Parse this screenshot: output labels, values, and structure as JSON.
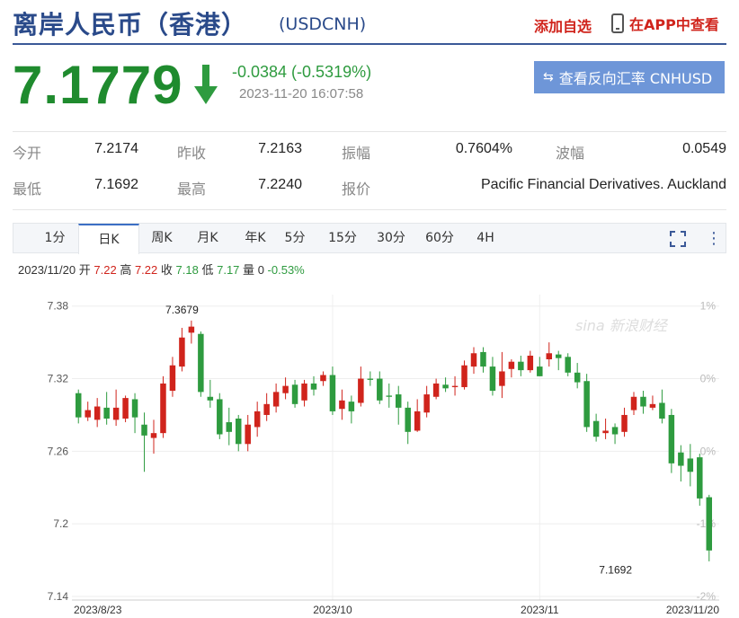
{
  "header": {
    "title": "离岸人民币（香港）",
    "symbol": "(USDCNH)",
    "add_favorite": "添加自选",
    "app_link": "在APP中查看"
  },
  "quote": {
    "price": "7.1779",
    "change": "-0.0384 (-0.5319%)",
    "timestamp": "2023-11-20 16:07:58",
    "reverse_button": "查看反向汇率 CNHUSD",
    "direction": "down",
    "down_color": "#2e9b3f",
    "up_color": "#d0241c"
  },
  "stats": {
    "row1": [
      {
        "label": "今开",
        "value": "7.2174"
      },
      {
        "label": "昨收",
        "value": "7.2163"
      },
      {
        "label": "振幅",
        "value": "0.7604%"
      },
      {
        "label": "波幅",
        "value": "0.0549"
      }
    ],
    "row2": [
      {
        "label": "最低",
        "value": "7.1692"
      },
      {
        "label": "最高",
        "value": "7.2240"
      },
      {
        "label": "报价",
        "value": "Pacific Financial Derivatives. Auckland"
      }
    ]
  },
  "tabs": {
    "items": [
      "1分",
      "日K",
      "周K",
      "月K",
      "年K",
      "5分",
      "15分",
      "30分",
      "60分",
      "4H"
    ],
    "active": "日K"
  },
  "ohlc": {
    "date": "2023/11/20",
    "open_label": "开",
    "open": "7.22",
    "high_label": "高",
    "high": "7.22",
    "close_label": "收",
    "close": "7.18",
    "low_label": "低",
    "low": "7.17",
    "vol_label": "量",
    "vol": "0",
    "pct": "-0.53%"
  },
  "chart_data": {
    "type": "candlestick",
    "watermark": "sina 新浪财经",
    "y_ticks": [
      "7.38",
      "7.32",
      "7.26",
      "7.2",
      "7.14"
    ],
    "y_ticks_values": [
      7.38,
      7.32,
      7.26,
      7.2,
      7.14
    ],
    "pct_ticks": [
      "1%",
      "0%",
      "0%",
      "-1%",
      "-2%"
    ],
    "x_ticks": [
      "2023/8/23",
      "2023/10",
      "2023/11",
      "2023/11/20"
    ],
    "x_ticks_index": [
      0,
      27,
      49,
      58
    ],
    "ylim": [
      7.14,
      7.385
    ],
    "annotations": [
      {
        "label": "7.3679",
        "index": 11,
        "value": 7.3679
      },
      {
        "label": "7.1692",
        "index": 59,
        "value": 7.1692
      }
    ],
    "candles": [
      [
        7.308,
        7.288,
        7.311,
        7.283
      ],
      [
        7.288,
        7.294,
        7.301,
        7.285
      ],
      [
        7.286,
        7.297,
        7.304,
        7.28
      ],
      [
        7.296,
        7.287,
        7.309,
        7.282
      ],
      [
        7.286,
        7.296,
        7.311,
        7.281
      ],
      [
        7.287,
        7.304,
        7.306,
        7.284
      ],
      [
        7.303,
        7.288,
        7.308,
        7.275
      ],
      [
        7.282,
        7.273,
        7.292,
        7.243
      ],
      [
        7.271,
        7.275,
        7.286,
        7.258
      ],
      [
        7.275,
        7.316,
        7.322,
        7.271
      ],
      [
        7.31,
        7.331,
        7.338,
        7.305
      ],
      [
        7.33,
        7.354,
        7.362,
        7.326
      ],
      [
        7.358,
        7.363,
        7.368,
        7.349
      ],
      [
        7.357,
        7.309,
        7.359,
        7.305
      ],
      [
        7.305,
        7.302,
        7.319,
        7.296
      ],
      [
        7.303,
        7.274,
        7.308,
        7.27
      ],
      [
        7.284,
        7.276,
        7.296,
        7.265
      ],
      [
        7.287,
        7.266,
        7.29,
        7.26
      ],
      [
        7.266,
        7.282,
        7.29,
        7.26
      ],
      [
        7.28,
        7.293,
        7.301,
        7.272
      ],
      [
        7.29,
        7.299,
        7.308,
        7.285
      ],
      [
        7.297,
        7.309,
        7.316,
        7.292
      ],
      [
        7.308,
        7.314,
        7.321,
        7.303
      ],
      [
        7.315,
        7.299,
        7.319,
        7.296
      ],
      [
        7.302,
        7.316,
        7.319,
        7.297
      ],
      [
        7.316,
        7.311,
        7.322,
        7.306
      ],
      [
        7.318,
        7.323,
        7.326,
        7.314
      ],
      [
        7.323,
        7.293,
        7.33,
        7.29
      ],
      [
        7.295,
        7.302,
        7.311,
        7.286
      ],
      [
        7.301,
        7.293,
        7.306,
        7.283
      ],
      [
        7.3,
        7.32,
        7.33,
        7.297
      ],
      [
        7.32,
        7.319,
        7.326,
        7.314
      ],
      [
        7.32,
        7.302,
        7.326,
        7.299
      ],
      [
        7.306,
        7.305,
        7.316,
        7.296
      ],
      [
        7.307,
        7.296,
        7.314,
        7.282
      ],
      [
        7.296,
        7.276,
        7.301,
        7.266
      ],
      [
        7.277,
        7.293,
        7.303,
        7.276
      ],
      [
        7.292,
        7.307,
        7.314,
        7.288
      ],
      [
        7.305,
        7.316,
        7.32,
        7.303
      ],
      [
        7.315,
        7.312,
        7.321,
        7.309
      ],
      [
        7.313,
        7.314,
        7.322,
        7.306
      ],
      [
        7.313,
        7.331,
        7.335,
        7.311
      ],
      [
        7.33,
        7.341,
        7.346,
        7.324
      ],
      [
        7.342,
        7.33,
        7.346,
        7.325
      ],
      [
        7.33,
        7.31,
        7.338,
        7.306
      ],
      [
        7.314,
        7.326,
        7.342,
        7.304
      ],
      [
        7.328,
        7.334,
        7.336,
        7.321
      ],
      [
        7.334,
        7.327,
        7.339,
        7.322
      ],
      [
        7.327,
        7.339,
        7.343,
        7.325
      ],
      [
        7.33,
        7.322,
        7.338,
        7.322
      ],
      [
        7.336,
        7.341,
        7.35,
        7.33
      ],
      [
        7.34,
        7.337,
        7.343,
        7.327
      ],
      [
        7.338,
        7.325,
        7.341,
        7.322
      ],
      [
        7.325,
        7.317,
        7.333,
        7.312
      ],
      [
        7.318,
        7.28,
        7.324,
        7.276
      ],
      [
        7.285,
        7.272,
        7.291,
        7.268
      ],
      [
        7.275,
        7.277,
        7.287,
        7.27
      ],
      [
        7.28,
        7.274,
        7.283,
        7.266
      ],
      [
        7.276,
        7.29,
        7.296,
        7.272
      ],
      [
        7.294,
        7.305,
        7.309,
        7.29
      ],
      [
        7.305,
        7.297,
        7.31,
        7.291
      ],
      [
        7.296,
        7.299,
        7.306,
        7.294
      ],
      [
        7.3,
        7.287,
        7.311,
        7.283
      ],
      [
        7.29,
        7.25,
        7.295,
        7.242
      ],
      [
        7.259,
        7.248,
        7.265,
        7.235
      ],
      [
        7.254,
        7.243,
        7.266,
        7.231
      ],
      [
        7.255,
        7.221,
        7.258,
        7.215
      ],
      [
        7.222,
        7.178,
        7.224,
        7.169
      ]
    ]
  }
}
